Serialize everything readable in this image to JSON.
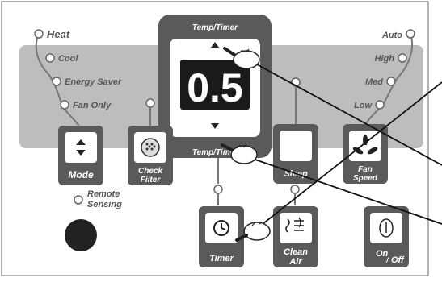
{
  "panel": {
    "mode_options": [
      "Heat",
      "Cool",
      "Energy Saver",
      "Fan Only"
    ],
    "fan_options": [
      "Auto",
      "High",
      "Med",
      "Low"
    ],
    "temp_timer_label": "Temp/Timer",
    "display_value": "0.5",
    "remote_sensing": [
      "Remote",
      "Sensing"
    ]
  },
  "buttons": {
    "mode": "Mode",
    "check_filter": [
      "Check",
      "Filter"
    ],
    "sleep": "Sleep",
    "fan_speed": [
      "Fan",
      "Speed"
    ],
    "timer": "Timer",
    "clean_air": [
      "Clean",
      "Air"
    ],
    "on_off_left": "On",
    "on_off_right": "Off"
  },
  "colors": {
    "band": "#bdbdbd",
    "button": "#5a5a5a",
    "display": "#1a1a1a",
    "digits": "#ffffff",
    "sensor": "#222222"
  }
}
